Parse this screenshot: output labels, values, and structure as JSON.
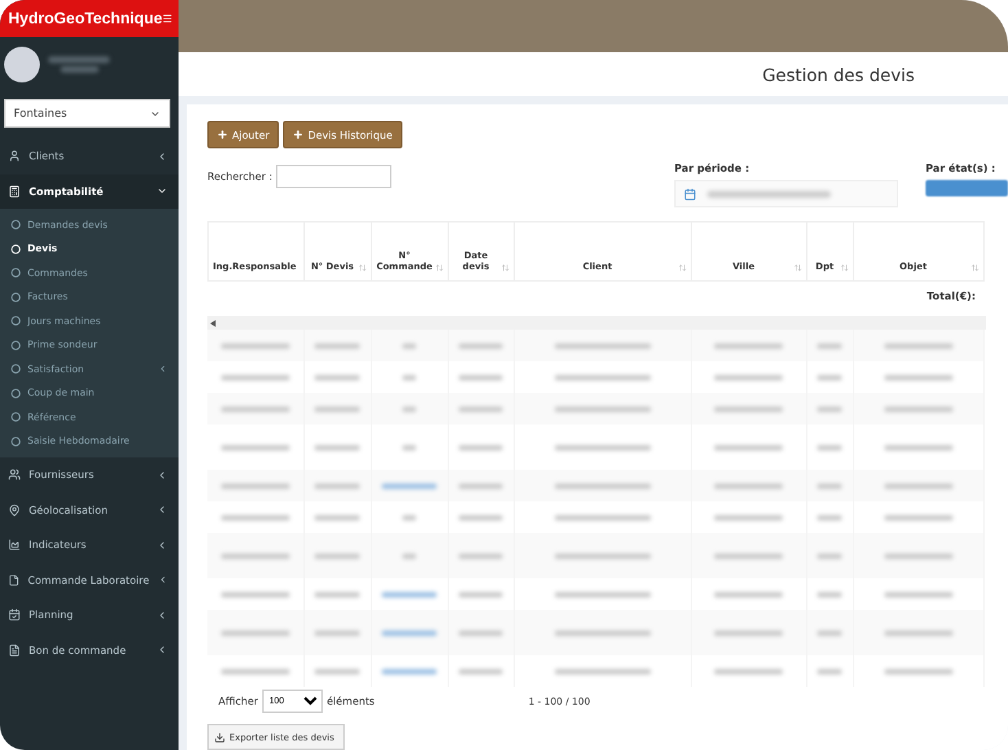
{
  "brand": "HydroGeoTechnique",
  "agency_select": {
    "value": "Fontaines"
  },
  "sidebar": {
    "items": [
      {
        "label": "Clients",
        "expanded": false,
        "has_arrow": true
      },
      {
        "label": "Comptabilité",
        "expanded": true,
        "has_arrow": true,
        "children": [
          {
            "label": "Demandes devis",
            "selected": false,
            "has_arrow": false
          },
          {
            "label": "Devis",
            "selected": true,
            "has_arrow": false
          },
          {
            "label": "Commandes",
            "selected": false,
            "has_arrow": false
          },
          {
            "label": "Factures",
            "selected": false,
            "has_arrow": false
          },
          {
            "label": "Jours machines",
            "selected": false,
            "has_arrow": false
          },
          {
            "label": "Prime sondeur",
            "selected": false,
            "has_arrow": false
          },
          {
            "label": "Satisfaction",
            "selected": false,
            "has_arrow": true
          },
          {
            "label": "Coup de main",
            "selected": false,
            "has_arrow": false
          },
          {
            "label": "Référence",
            "selected": false,
            "has_arrow": false
          },
          {
            "label": "Saisie Hebdomadaire",
            "selected": false,
            "has_arrow": false
          }
        ]
      },
      {
        "label": "Fournisseurs",
        "expanded": false,
        "has_arrow": true
      },
      {
        "label": "Géolocalisation",
        "expanded": false,
        "has_arrow": true
      },
      {
        "label": "Indicateurs",
        "expanded": false,
        "has_arrow": true
      },
      {
        "label": "Commande Laboratoire",
        "expanded": false,
        "has_arrow": true
      },
      {
        "label": "Planning",
        "expanded": false,
        "has_arrow": true
      },
      {
        "label": "Bon de commande",
        "expanded": false,
        "has_arrow": true
      }
    ]
  },
  "page_title": "Gestion des devis",
  "buttons": [
    {
      "label": "Ajouter"
    },
    {
      "label": "Devis Historique"
    }
  ],
  "search": {
    "label": "Rechercher :"
  },
  "filters": [
    {
      "label": "Par période :",
      "kind": "date"
    },
    {
      "label": "Par état(s) :",
      "kind": "state"
    }
  ],
  "table": {
    "columns": [
      "Ing.Responsable",
      "N° Devis",
      "N° Commande",
      "Date devis",
      "Client",
      "Ville",
      "Dpt",
      "Objet"
    ],
    "total_label": "Total(€):",
    "rows": [
      {
        "tall": false,
        "order_link": false
      },
      {
        "tall": false,
        "order_link": false
      },
      {
        "tall": false,
        "order_link": false
      },
      {
        "tall": true,
        "order_link": false
      },
      {
        "tall": false,
        "order_link": true
      },
      {
        "tall": false,
        "order_link": false
      },
      {
        "tall": true,
        "order_link": false
      },
      {
        "tall": false,
        "order_link": true
      },
      {
        "tall": true,
        "order_link": true
      },
      {
        "tall": false,
        "order_link": true
      }
    ]
  },
  "page_size": {
    "prefix": "Afficher",
    "value": "100",
    "suffix": "éléments"
  },
  "pagination": "1 - 100 / 100",
  "export_button": "Exporter liste des devis"
}
